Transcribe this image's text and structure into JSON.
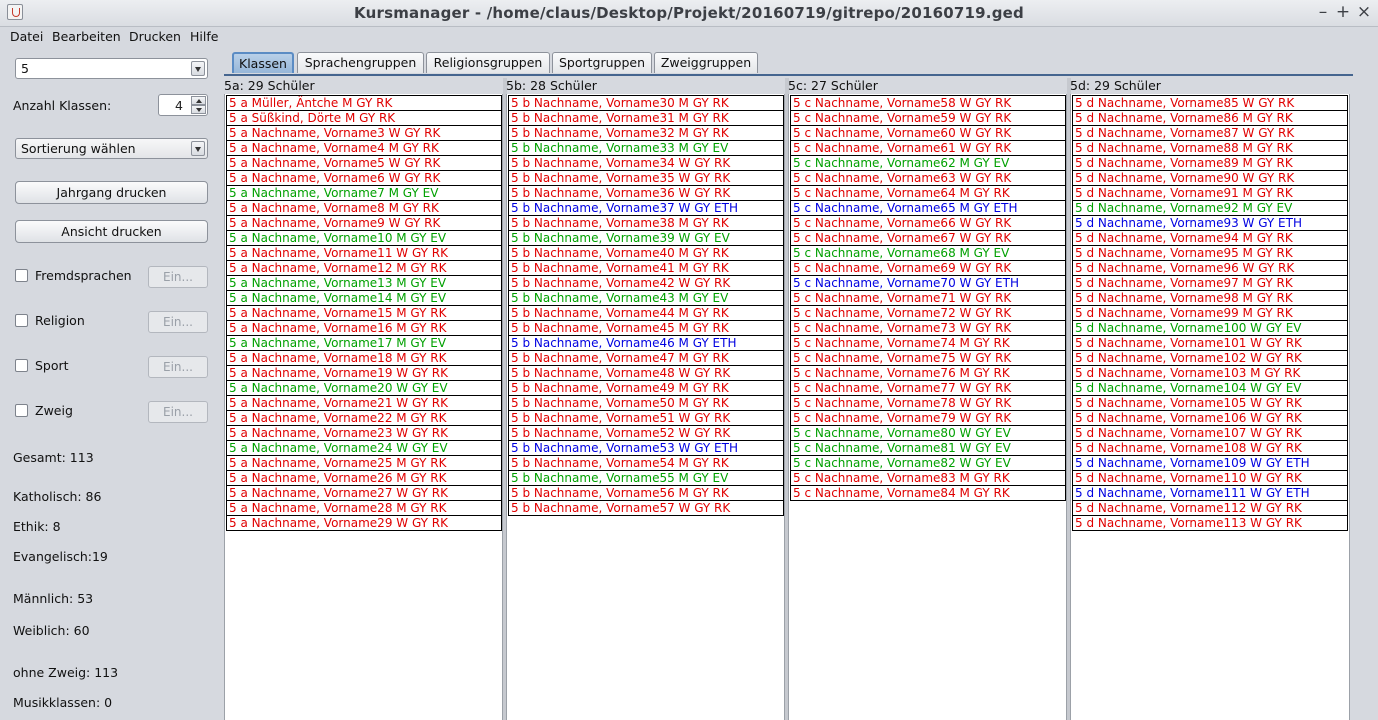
{
  "window": {
    "title": "Kursmanager - /home/claus/Desktop/Projekt/20160719/gitrepo/20160719.ged"
  },
  "menu": [
    "Datei",
    "Bearbeiten",
    "Drucken",
    "Hilfe"
  ],
  "colors": {
    "M_GY_RK": "#e00000",
    "W_GY_RK": "#e00000",
    "EV": "#00a000",
    "ETH": "#0000e0"
  },
  "sidebar": {
    "jahrgang": "5",
    "anzahl_label": "Anzahl Klassen:",
    "anzahl_value": "4",
    "sort_label": "Sortierung wählen",
    "btn_jahrgang": "Jahrgang drucken",
    "btn_ansicht": "Ansicht drucken",
    "checks": [
      {
        "label": "Fremdsprachen",
        "btn": "Ein..."
      },
      {
        "label": "Religion",
        "btn": "Ein..."
      },
      {
        "label": "Sport",
        "btn": "Ein..."
      },
      {
        "label": "Zweig",
        "btn": "Ein..."
      }
    ],
    "stats": {
      "gesamt": "Gesamt: 113",
      "katholisch": "Katholisch: 86",
      "ethik": "Ethik: 8",
      "evangelisch": "Evangelisch:19",
      "maennlich": "Männlich: 53",
      "weiblich": "Weiblich: 60",
      "ohne_zweig": "ohne Zweig: 113",
      "musikklassen": "Musikklassen: 0"
    }
  },
  "tabs": [
    "Klassen",
    "Sprachengruppen",
    "Religionsgruppen",
    "Sportgruppen",
    "Zweiggruppen"
  ],
  "active_tab": 0,
  "classes": [
    {
      "title": "5a: 29 Schüler",
      "students": [
        [
          "5 a Müller, Äntche M GY RK",
          "r"
        ],
        [
          "5 a Süßkind, Dörte M GY RK",
          "r"
        ],
        [
          "5 a Nachname, Vorname3 W GY RK",
          "r"
        ],
        [
          "5 a Nachname, Vorname4 M GY RK",
          "r"
        ],
        [
          "5 a Nachname, Vorname5 W GY RK",
          "r"
        ],
        [
          "5 a Nachname, Vorname6 W GY RK",
          "r"
        ],
        [
          "5 a Nachname, Vorname7 M GY EV",
          "g"
        ],
        [
          "5 a Nachname, Vorname8 M GY RK",
          "r"
        ],
        [
          "5 a Nachname, Vorname9 W GY RK",
          "r"
        ],
        [
          "5 a Nachname, Vorname10 M GY EV",
          "g"
        ],
        [
          "5 a Nachname, Vorname11 W GY RK",
          "r"
        ],
        [
          "5 a Nachname, Vorname12 M GY RK",
          "r"
        ],
        [
          "5 a Nachname, Vorname13 M GY EV",
          "g"
        ],
        [
          "5 a Nachname, Vorname14 M GY EV",
          "g"
        ],
        [
          "5 a Nachname, Vorname15 M GY RK",
          "r"
        ],
        [
          "5 a Nachname, Vorname16 M GY RK",
          "r"
        ],
        [
          "5 a Nachname, Vorname17 M GY EV",
          "g"
        ],
        [
          "5 a Nachname, Vorname18 M GY RK",
          "r"
        ],
        [
          "5 a Nachname, Vorname19 W GY RK",
          "r"
        ],
        [
          "5 a Nachname, Vorname20 W GY EV",
          "g"
        ],
        [
          "5 a Nachname, Vorname21 W GY RK",
          "r"
        ],
        [
          "5 a Nachname, Vorname22 M GY RK",
          "r"
        ],
        [
          "5 a Nachname, Vorname23 W GY RK",
          "r"
        ],
        [
          "5 a Nachname, Vorname24 W GY EV",
          "g"
        ],
        [
          "5 a Nachname, Vorname25 M GY RK",
          "r"
        ],
        [
          "5 a Nachname, Vorname26 M GY RK",
          "r"
        ],
        [
          "5 a Nachname, Vorname27 W GY RK",
          "r"
        ],
        [
          "5 a Nachname, Vorname28 M GY RK",
          "r"
        ],
        [
          "5 a Nachname, Vorname29 W GY RK",
          "r"
        ]
      ]
    },
    {
      "title": "5b: 28 Schüler",
      "students": [
        [
          "5 b Nachname, Vorname30 M GY RK",
          "r"
        ],
        [
          "5 b Nachname, Vorname31 M GY RK",
          "r"
        ],
        [
          "5 b Nachname, Vorname32 M GY RK",
          "r"
        ],
        [
          "5 b Nachname, Vorname33 M GY EV",
          "g"
        ],
        [
          "5 b Nachname, Vorname34 W GY RK",
          "r"
        ],
        [
          "5 b Nachname, Vorname35 W GY RK",
          "r"
        ],
        [
          "5 b Nachname, Vorname36 W GY RK",
          "r"
        ],
        [
          "5 b Nachname, Vorname37 W GY ETH",
          "b"
        ],
        [
          "5 b Nachname, Vorname38 M GY RK",
          "r"
        ],
        [
          "5 b Nachname, Vorname39 W GY EV",
          "g"
        ],
        [
          "5 b Nachname, Vorname40 M GY RK",
          "r"
        ],
        [
          "5 b Nachname, Vorname41 M GY RK",
          "r"
        ],
        [
          "5 b Nachname, Vorname42 W GY RK",
          "r"
        ],
        [
          "5 b Nachname, Vorname43 M GY EV",
          "g"
        ],
        [
          "5 b Nachname, Vorname44 M GY RK",
          "r"
        ],
        [
          "5 b Nachname, Vorname45 M GY RK",
          "r"
        ],
        [
          "5 b Nachname, Vorname46 M GY ETH",
          "b"
        ],
        [
          "5 b Nachname, Vorname47 M GY RK",
          "r"
        ],
        [
          "5 b Nachname, Vorname48 W GY RK",
          "r"
        ],
        [
          "5 b Nachname, Vorname49 M GY RK",
          "r"
        ],
        [
          "5 b Nachname, Vorname50 M GY RK",
          "r"
        ],
        [
          "5 b Nachname, Vorname51 W GY RK",
          "r"
        ],
        [
          "5 b Nachname, Vorname52 W GY RK",
          "r"
        ],
        [
          "5 b Nachname, Vorname53 W GY ETH",
          "b"
        ],
        [
          "5 b Nachname, Vorname54 M GY RK",
          "r"
        ],
        [
          "5 b Nachname, Vorname55 M GY EV",
          "g"
        ],
        [
          "5 b Nachname, Vorname56 M GY RK",
          "r"
        ],
        [
          "5 b Nachname, Vorname57 W GY RK",
          "r"
        ]
      ]
    },
    {
      "title": "5c: 27 Schüler",
      "students": [
        [
          "5 c Nachname, Vorname58 W GY RK",
          "r"
        ],
        [
          "5 c Nachname, Vorname59 W GY RK",
          "r"
        ],
        [
          "5 c Nachname, Vorname60 W GY RK",
          "r"
        ],
        [
          "5 c Nachname, Vorname61 W GY RK",
          "r"
        ],
        [
          "5 c Nachname, Vorname62 M GY EV",
          "g"
        ],
        [
          "5 c Nachname, Vorname63 W GY RK",
          "r"
        ],
        [
          "5 c Nachname, Vorname64 M GY RK",
          "r"
        ],
        [
          "5 c Nachname, Vorname65 M GY ETH",
          "b"
        ],
        [
          "5 c Nachname, Vorname66 W GY RK",
          "r"
        ],
        [
          "5 c Nachname, Vorname67 W GY RK",
          "r"
        ],
        [
          "5 c Nachname, Vorname68 M GY EV",
          "g"
        ],
        [
          "5 c Nachname, Vorname69 W GY RK",
          "r"
        ],
        [
          "5 c Nachname, Vorname70 W GY ETH",
          "b"
        ],
        [
          "5 c Nachname, Vorname71 W GY RK",
          "r"
        ],
        [
          "5 c Nachname, Vorname72 W GY RK",
          "r"
        ],
        [
          "5 c Nachname, Vorname73 W GY RK",
          "r"
        ],
        [
          "5 c Nachname, Vorname74 M GY RK",
          "r"
        ],
        [
          "5 c Nachname, Vorname75 W GY RK",
          "r"
        ],
        [
          "5 c Nachname, Vorname76 M GY RK",
          "r"
        ],
        [
          "5 c Nachname, Vorname77 W GY RK",
          "r"
        ],
        [
          "5 c Nachname, Vorname78 W GY RK",
          "r"
        ],
        [
          "5 c Nachname, Vorname79 W GY RK",
          "r"
        ],
        [
          "5 c Nachname, Vorname80 W GY EV",
          "g"
        ],
        [
          "5 c Nachname, Vorname81 W GY EV",
          "g"
        ],
        [
          "5 c Nachname, Vorname82 W GY EV",
          "g"
        ],
        [
          "5 c Nachname, Vorname83 M GY RK",
          "r"
        ],
        [
          "5 c Nachname, Vorname84 M GY RK",
          "r"
        ]
      ]
    },
    {
      "title": "5d: 29 Schüler",
      "students": [
        [
          "5 d Nachname, Vorname85 W GY RK",
          "r"
        ],
        [
          "5 d Nachname, Vorname86 M GY RK",
          "r"
        ],
        [
          "5 d Nachname, Vorname87 W GY RK",
          "r"
        ],
        [
          "5 d Nachname, Vorname88 M GY RK",
          "r"
        ],
        [
          "5 d Nachname, Vorname89 M GY RK",
          "r"
        ],
        [
          "5 d Nachname, Vorname90 W GY RK",
          "r"
        ],
        [
          "5 d Nachname, Vorname91 M GY RK",
          "r"
        ],
        [
          "5 d Nachname, Vorname92 M GY EV",
          "g"
        ],
        [
          "5 d Nachname, Vorname93 W GY ETH",
          "b"
        ],
        [
          "5 d Nachname, Vorname94 M GY RK",
          "r"
        ],
        [
          "5 d Nachname, Vorname95 M GY RK",
          "r"
        ],
        [
          "5 d Nachname, Vorname96 W GY RK",
          "r"
        ],
        [
          "5 d Nachname, Vorname97 M GY RK",
          "r"
        ],
        [
          "5 d Nachname, Vorname98 M GY RK",
          "r"
        ],
        [
          "5 d Nachname, Vorname99 M GY RK",
          "r"
        ],
        [
          "5 d Nachname, Vorname100 W GY EV",
          "g"
        ],
        [
          "5 d Nachname, Vorname101 W GY RK",
          "r"
        ],
        [
          "5 d Nachname, Vorname102 W GY RK",
          "r"
        ],
        [
          "5 d Nachname, Vorname103 M GY RK",
          "r"
        ],
        [
          "5 d Nachname, Vorname104 W GY EV",
          "g"
        ],
        [
          "5 d Nachname, Vorname105 W GY RK",
          "r"
        ],
        [
          "5 d Nachname, Vorname106 W GY RK",
          "r"
        ],
        [
          "5 d Nachname, Vorname107 W GY RK",
          "r"
        ],
        [
          "5 d Nachname, Vorname108 W GY RK",
          "r"
        ],
        [
          "5 d Nachname, Vorname109 W GY ETH",
          "b"
        ],
        [
          "5 d Nachname, Vorname110 W GY RK",
          "r"
        ],
        [
          "5 d Nachname, Vorname111 W GY ETH",
          "b"
        ],
        [
          "5 d Nachname, Vorname112 W GY RK",
          "r"
        ],
        [
          "5 d Nachname, Vorname113 W GY RK",
          "r"
        ]
      ]
    }
  ]
}
